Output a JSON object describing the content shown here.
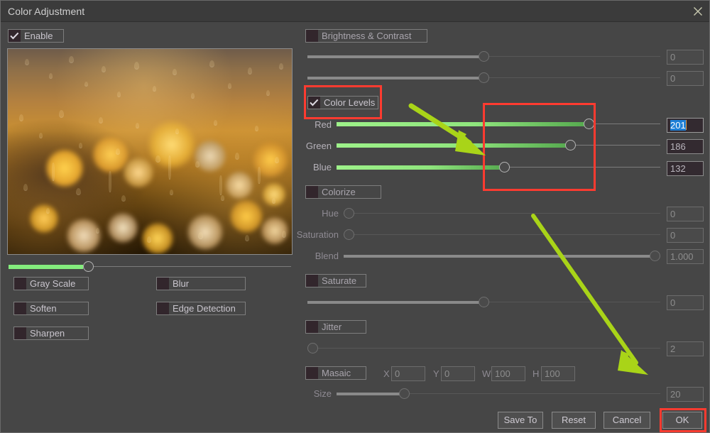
{
  "window": {
    "title": "Color Adjustment",
    "close_icon": "close-x-icon"
  },
  "left_panel": {
    "enable": {
      "label": "Enable",
      "checked": true
    },
    "preview_alt": "rain-drops-on-glass-golden-bokeh-preview",
    "opacity_slider": {
      "value_pct": 29
    },
    "toggles": [
      {
        "label": "Gray Scale",
        "checked": false
      },
      {
        "label": "Blur",
        "checked": false
      },
      {
        "label": "Soften",
        "checked": false
      },
      {
        "label": "Edge Detection",
        "checked": false
      },
      {
        "label": "Sharpen",
        "checked": false
      }
    ]
  },
  "right_panel": {
    "brightness_contrast": {
      "label": "Brightness & Contrast",
      "checked": false,
      "sliders": [
        {
          "name": "brightness",
          "value": "0",
          "pct": 50
        },
        {
          "name": "contrast",
          "value": "0",
          "pct": 50
        }
      ]
    },
    "color_levels": {
      "label": "Color Levels",
      "checked": true,
      "channels": [
        {
          "label": "Red",
          "value": "201",
          "pct": 78,
          "selected": true
        },
        {
          "label": "Green",
          "value": "186",
          "pct": 72,
          "selected": false
        },
        {
          "label": "Blue",
          "value": "132",
          "pct": 51,
          "selected": false
        }
      ]
    },
    "colorize": {
      "label": "Colorize",
      "checked": false,
      "rows": [
        {
          "label": "Hue",
          "value": "0",
          "pct": 0
        },
        {
          "label": "Saturation",
          "value": "0",
          "pct": 0
        },
        {
          "label": "Blend",
          "value": "1.000",
          "pct": 100
        }
      ]
    },
    "saturate": {
      "label": "Saturate",
      "checked": false,
      "slider": {
        "value": "0",
        "pct": 50
      }
    },
    "jitter": {
      "label": "Jitter",
      "checked": false,
      "slider": {
        "value": "2",
        "pct": 0
      }
    },
    "mosaic": {
      "label": "Masaic",
      "checked": false,
      "fields": [
        {
          "cap": "X",
          "value": "0"
        },
        {
          "cap": "Y",
          "value": "0"
        },
        {
          "cap": "W",
          "value": "100"
        },
        {
          "cap": "H",
          "value": "100"
        }
      ],
      "size": {
        "label": "Size",
        "value": "20",
        "pct": 26
      }
    }
  },
  "footer": {
    "buttons": [
      {
        "name": "save-to",
        "label": "Save To"
      },
      {
        "name": "reset",
        "label": "Reset"
      },
      {
        "name": "cancel",
        "label": "Cancel"
      },
      {
        "name": "ok",
        "label": "OK"
      }
    ]
  },
  "annotations": {
    "highlight_color": "#ff3b30",
    "arrow_color": "#a9d418",
    "boxes": [
      {
        "name": "color-levels-checkbox-highlight"
      },
      {
        "name": "rgb-slider-knobs-highlight"
      },
      {
        "name": "ok-button-highlight"
      }
    ],
    "arrows": [
      {
        "name": "arrow-to-rgb-sliders"
      },
      {
        "name": "arrow-to-ok-button"
      }
    ]
  }
}
